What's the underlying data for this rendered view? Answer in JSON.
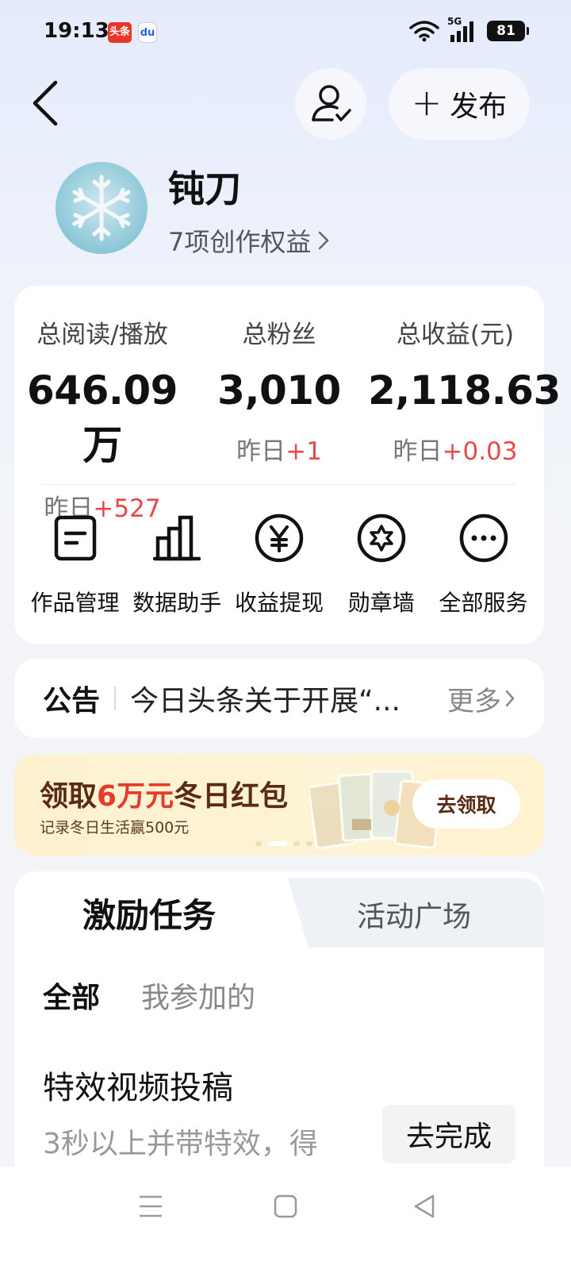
{
  "status_bar": {
    "time": "19:13",
    "badge_toutiao": "头条",
    "badge_baidu": "du",
    "network": "5G",
    "battery": "81"
  },
  "header": {
    "publish_label": "发布"
  },
  "profile": {
    "name": "钝刀",
    "benefits": "7项创作权益"
  },
  "stats": [
    {
      "label": "总阅读/播放",
      "value": "646.09万",
      "delta_prefix": "昨日",
      "delta": "+527"
    },
    {
      "label": "总粉丝",
      "value": "3,010",
      "delta_prefix": "昨日",
      "delta": "+1"
    },
    {
      "label": "总收益(元)",
      "value": "2,118.63",
      "delta_prefix": "昨日",
      "delta": "+0.03"
    }
  ],
  "tools": [
    {
      "label": "作品管理",
      "icon": "document-icon"
    },
    {
      "label": "数据助手",
      "icon": "bar-chart-icon"
    },
    {
      "label": "收益提现",
      "icon": "yen-icon"
    },
    {
      "label": "勋章墙",
      "icon": "badge-icon"
    },
    {
      "label": "全部服务",
      "icon": "more-icon"
    }
  ],
  "notice": {
    "title": "公告",
    "text": "今日头条关于开展“...",
    "more": "更多"
  },
  "banner": {
    "title_prefix": "领取",
    "title_highlight": "6万元",
    "title_suffix": "冬日红包",
    "subtitle": "记录冬日生活赢500元",
    "button": "去领取"
  },
  "tasks": {
    "tab_active": "激励任务",
    "tab_inactive": "活动广场",
    "filter_all": "全部",
    "filter_mine": "我参加的",
    "items": [
      {
        "title": "特效视频投稿",
        "desc": "3秒以上并带特效，得",
        "action": "去完成"
      }
    ]
  },
  "colors": {
    "accent_red": "#e8484a",
    "banner_brown": "#5a2a12"
  }
}
